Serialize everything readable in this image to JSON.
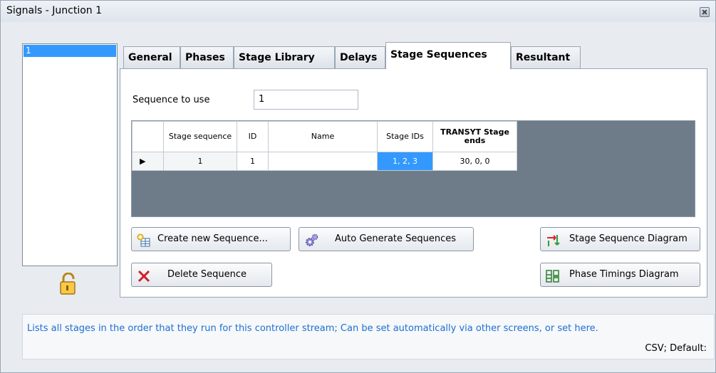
{
  "window": {
    "title": "Signals - Junction 1"
  },
  "junction_list": {
    "items": [
      "1"
    ]
  },
  "tabs": [
    "General",
    "Phases",
    "Stage Library",
    "Delays",
    "Stage Sequences",
    "Resultant"
  ],
  "active_tab": "Stage Sequences",
  "sequence": {
    "label": "Sequence to use",
    "value": "1"
  },
  "grid": {
    "headers": [
      "Stage sequence",
      "ID",
      "Name",
      "Stage IDs",
      "TRANSYT Stage ends"
    ],
    "rows": [
      {
        "indicator": "▶",
        "stage_sequence": "1",
        "id": "1",
        "name": "",
        "stage_ids": "1, 2, 3",
        "transyt_stage_ends": "30, 0, 0"
      }
    ]
  },
  "buttons": {
    "create": "Create new Sequence...",
    "auto": "Auto Generate Sequences",
    "stage_diagram": "Stage Sequence Diagram",
    "delete": "Delete Sequence",
    "phase_diagram": "Phase Timings Diagram"
  },
  "status": {
    "text": "Lists all stages in the order that they run for this controller stream; Can be set automatically via other screens, or set here.",
    "right": "CSV; Default:"
  },
  "colors": {
    "accent": "#3399ff",
    "grid_bg": "#6e7c89",
    "status_text": "#1f6fd1"
  }
}
